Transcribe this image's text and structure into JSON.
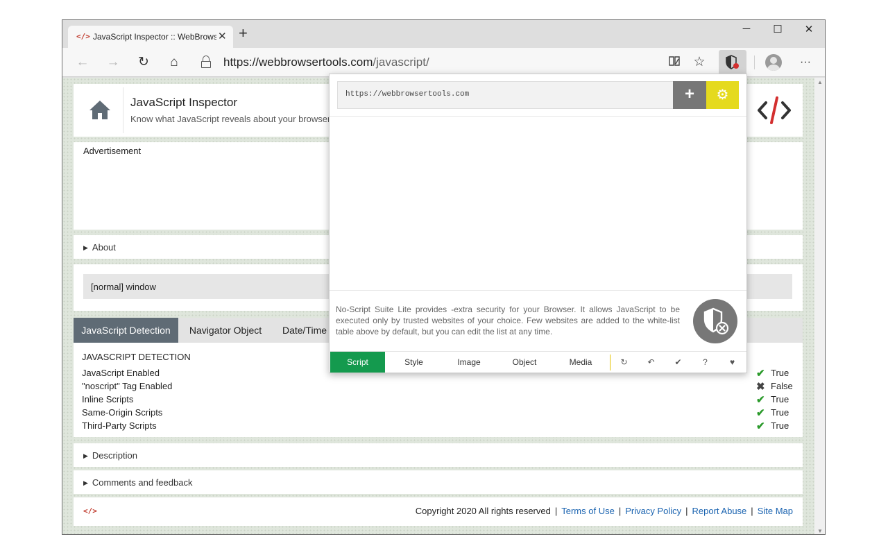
{
  "browser": {
    "tab_title": "JavaScript Inspector :: WebBrowserTools",
    "tab_favicon": "</>",
    "tab_close": "✕",
    "new_tab": "+",
    "url_host": "https://webbrowsertools.com",
    "url_path": "/javascript/",
    "icons": {
      "back": "←",
      "forward": "→",
      "reload": "↻",
      "home": "⌂",
      "favorite": "☆",
      "menu": "···",
      "minimize": "─",
      "maximize": "☐",
      "close": "✕"
    }
  },
  "page": {
    "site_title": "JavaScript Inspector",
    "site_subtitle": "Know what JavaScript reveals about your browser",
    "ad_label": "Advertisement",
    "about_label": "About",
    "window_text": "[normal] window",
    "tabs": [
      "JavaScript Detection",
      "Navigator Object",
      "Date/Time"
    ],
    "detection_title": "JAVASCRIPT DETECTION",
    "detection_rows": [
      {
        "name": "JavaScript Enabled",
        "mark": "✔",
        "value": "True"
      },
      {
        "name": "\"noscript\" Tag Enabled",
        "mark": "✖",
        "value": "False"
      },
      {
        "name": "Inline Scripts",
        "mark": "✔",
        "value": "True"
      },
      {
        "name": "Same-Origin Scripts",
        "mark": "✔",
        "value": "True"
      },
      {
        "name": "Third-Party Scripts",
        "mark": "✔",
        "value": "True"
      }
    ],
    "description_label": "Description",
    "comments_label": "Comments and feedback",
    "footer": {
      "logo": "</>",
      "copyright": "Copyright 2020 All rights reserved",
      "links": [
        "Terms of Use",
        "Privacy Policy",
        "Report Abuse",
        "Site Map"
      ],
      "separator": "|"
    }
  },
  "popup": {
    "input_value": "https://webbrowsertools.com",
    "add_label": "+",
    "settings_label": "⚙",
    "description": "No-Script Suite Lite provides -extra security for your Browser. It allows JavaScript to be executed only by trusted websites of your choice. Few websites are added to the white-list table above by default, but you can edit the list at any time.",
    "types": [
      "Script",
      "Style",
      "Image",
      "Object",
      "Media"
    ],
    "active_type": "Script",
    "actions": [
      "↻",
      "↶",
      "✔",
      "?",
      "♥"
    ]
  },
  "colors": {
    "active_tab": "#5f6b75",
    "popup_active": "#149a4e",
    "popup_gear": "#e5da1e",
    "popup_add": "#777777",
    "link": "#1a63b0",
    "check": "#2b9a2b",
    "logo_red": "#c0392b"
  }
}
